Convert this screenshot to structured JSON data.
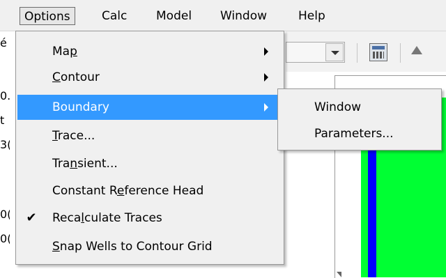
{
  "menubar": {
    "items": [
      {
        "label": "Options"
      },
      {
        "label": "Calc"
      },
      {
        "label": "Model"
      },
      {
        "label": "Window"
      },
      {
        "label": "Help"
      }
    ]
  },
  "background": {
    "left_fragments": [
      "é",
      "0.",
      "t",
      "3(",
      "",
      "0(",
      "0("
    ],
    "colors": {
      "green": "#00ff33",
      "blue": "#0000ff"
    }
  },
  "options_menu": {
    "items": [
      {
        "pre": "Ma",
        "key": "p",
        "post": "",
        "has_submenu": true
      },
      {
        "pre": "",
        "key": "C",
        "post": "ontour",
        "has_submenu": true
      },
      {
        "pre": "",
        "key": "B",
        "post": "oundary",
        "has_submenu": true,
        "highlighted": true
      },
      {
        "pre": "",
        "key": "T",
        "post": "race...",
        "has_submenu": false
      },
      {
        "pre": "Tra",
        "key": "n",
        "post": "sient...",
        "has_submenu": false
      },
      {
        "pre": "Constant R",
        "key": "e",
        "post": "ference Head",
        "has_submenu": false
      },
      {
        "pre": "Reca",
        "key": "l",
        "post": "culate Traces",
        "has_submenu": false,
        "checked": true,
        "check_glyph": "✔"
      },
      {
        "pre": "",
        "key": "S",
        "post": "nap Wells to Contour Grid",
        "has_submenu": false
      }
    ],
    "highlight_color": "#3399ff"
  },
  "boundary_submenu": {
    "items": [
      {
        "label": "Window"
      },
      {
        "label": "Parameters..."
      }
    ]
  }
}
